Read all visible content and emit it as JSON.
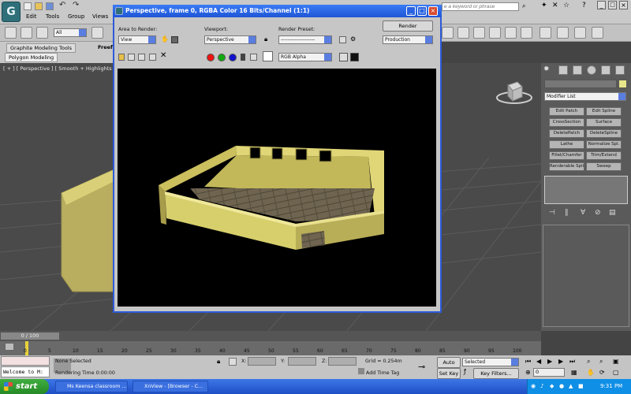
{
  "menubar": {
    "items": [
      "Edit",
      "Tools",
      "Group",
      "Views"
    ],
    "search_placeholder": "e a keyword or phrase",
    "workspace_value": "All"
  },
  "ribbon": {
    "tabs": [
      "Graphite Modeling Tools",
      "Freefo"
    ],
    "subtab": "Polygon Modeling"
  },
  "viewport": {
    "label": "[ + ] [ Perspective ] [ Smooth + Highlights ]"
  },
  "render_window": {
    "title": "Perspective, frame 0, RGBA Color 16 Bits/Channel (1:1)",
    "area_to_render_label": "Area to Render:",
    "area_to_render_value": "View",
    "viewport_label": "Viewport:",
    "viewport_value": "Perspective",
    "render_preset_label": "Render Preset:",
    "render_preset_value": "--------------------",
    "render_button": "Render",
    "production_value": "Production",
    "channel_value": "RGB Alpha",
    "close_glyph": "×",
    "min_glyph": "_",
    "max_glyph": "□"
  },
  "command_panel": {
    "modifier_list": "Modifier List",
    "modifiers": [
      "Edit Patch",
      "Edit Spline",
      "CrossSection",
      "Surface",
      "DeletePatch",
      "DeleteSpline",
      "Lathe",
      "Normalize Spl.",
      "Fillet/Chamfer",
      "Trim/Extend",
      "Renderable Spline",
      "Sweep"
    ]
  },
  "timeline": {
    "frame_counter": "0 / 100",
    "ticks": [
      "0",
      "5",
      "10",
      "15",
      "20",
      "25",
      "30",
      "35",
      "40",
      "45",
      "50",
      "55",
      "60",
      "65",
      "70",
      "75",
      "80",
      "85",
      "90",
      "95",
      "100"
    ]
  },
  "status": {
    "maxscript_text": "Welcome to M:",
    "selection": "None Selected",
    "rendering_time": "Rendering Time  0:00:00",
    "x_label": "X:",
    "y_label": "Y:",
    "z_label": "Z:",
    "grid": "Grid = 0.254m",
    "add_time_tag": "Add Time Tag",
    "auto_key": "Auto Key",
    "set_key": "Set Key",
    "selected_value": "Selected",
    "key_filters": "Key Filters...",
    "frame_value": "0"
  },
  "taskbar": {
    "start": "start",
    "tasks": [
      "Ms Keensa classroom ...",
      "XnView - [Browser - C..."
    ],
    "clock": "9:31 PM"
  },
  "colors": {
    "title_blue": "#1f56d6",
    "wall_yellow": "#d6cf6c",
    "floor_wood": "#6e6450"
  }
}
